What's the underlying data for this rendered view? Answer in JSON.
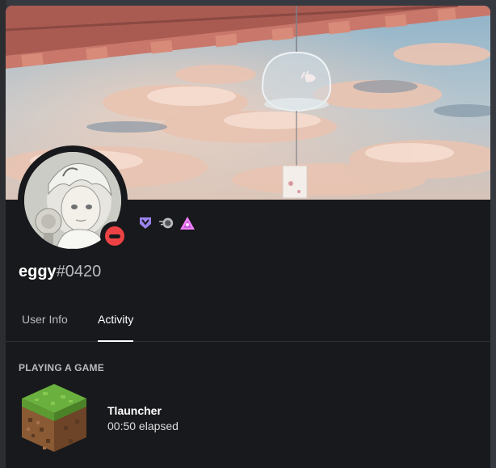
{
  "profile": {
    "username": "eggy",
    "discriminator": "#0420",
    "status": "dnd",
    "badges": [
      "hypesquad-bravery-icon",
      "nitro-boost-icon",
      "hypesquad-events-icon"
    ]
  },
  "tabs": [
    {
      "label": "User Info",
      "active": false
    },
    {
      "label": "Activity",
      "active": true
    }
  ],
  "activity": {
    "section_title": "PLAYING A GAME",
    "game_name": "Tlauncher",
    "elapsed": "00:50 elapsed",
    "icon": "minecraft-grass-block-icon"
  },
  "colors": {
    "background": "#18191c",
    "dnd": "#ed4245",
    "hypesquad": "#9c84ef"
  }
}
